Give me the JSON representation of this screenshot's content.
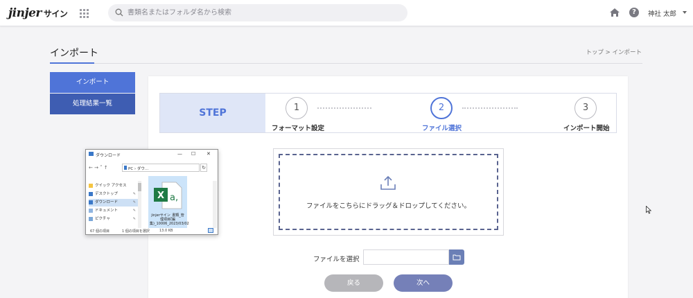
{
  "header": {
    "logo": "jinjer",
    "logo_sub": "サイン",
    "search_placeholder": "書類名またはフォルダ名から検索",
    "help_icon": "?",
    "user_name": "神社 太郎"
  },
  "page": {
    "title": "インポート",
    "breadcrumb": "トップ > インポート"
  },
  "sidebar": {
    "items": [
      {
        "label": "インポート",
        "active": true
      },
      {
        "label": "処理結果一覧",
        "active": false
      }
    ]
  },
  "steps": {
    "label": "STEP",
    "items": [
      {
        "number": "1",
        "label": "フォーマット設定",
        "active": false
      },
      {
        "number": "2",
        "label": "ファイル選択",
        "active": true
      },
      {
        "number": "3",
        "label": "インポート開始",
        "active": false
      }
    ]
  },
  "dropzone": {
    "text": "ファイルをこちらにドラッグ＆ドロップしてください。"
  },
  "file_select": {
    "label": "ファイルを選択",
    "value": ""
  },
  "buttons": {
    "back": "戻る",
    "next": "次へ"
  },
  "explorer": {
    "title": "ダウンロード",
    "path": "PC › ダウ...",
    "minimize": "—",
    "maximize": "☐",
    "close": "✕",
    "sidebar_items": [
      {
        "label": "クイック アクセス",
        "selected": false
      },
      {
        "label": "デスクトップ",
        "selected": false
      },
      {
        "label": "ダウンロード",
        "selected": true
      },
      {
        "label": "ドキュメント",
        "selected": false
      },
      {
        "label": "ピクチャ",
        "selected": false
      }
    ],
    "file_name": "jinjerサイン_書類_管理項目(編集)_10006_2023/03/02",
    "status_count": "67 個の項目",
    "status_selected": "1 個の項目を選択",
    "status_size": "13.0 KB"
  },
  "colors": {
    "accent": "#4f74d8",
    "sidebar_inactive": "#3e5db2",
    "next_button": "#7580b8",
    "back_button": "#b6b6ba",
    "dashed_border": "#59638f"
  }
}
